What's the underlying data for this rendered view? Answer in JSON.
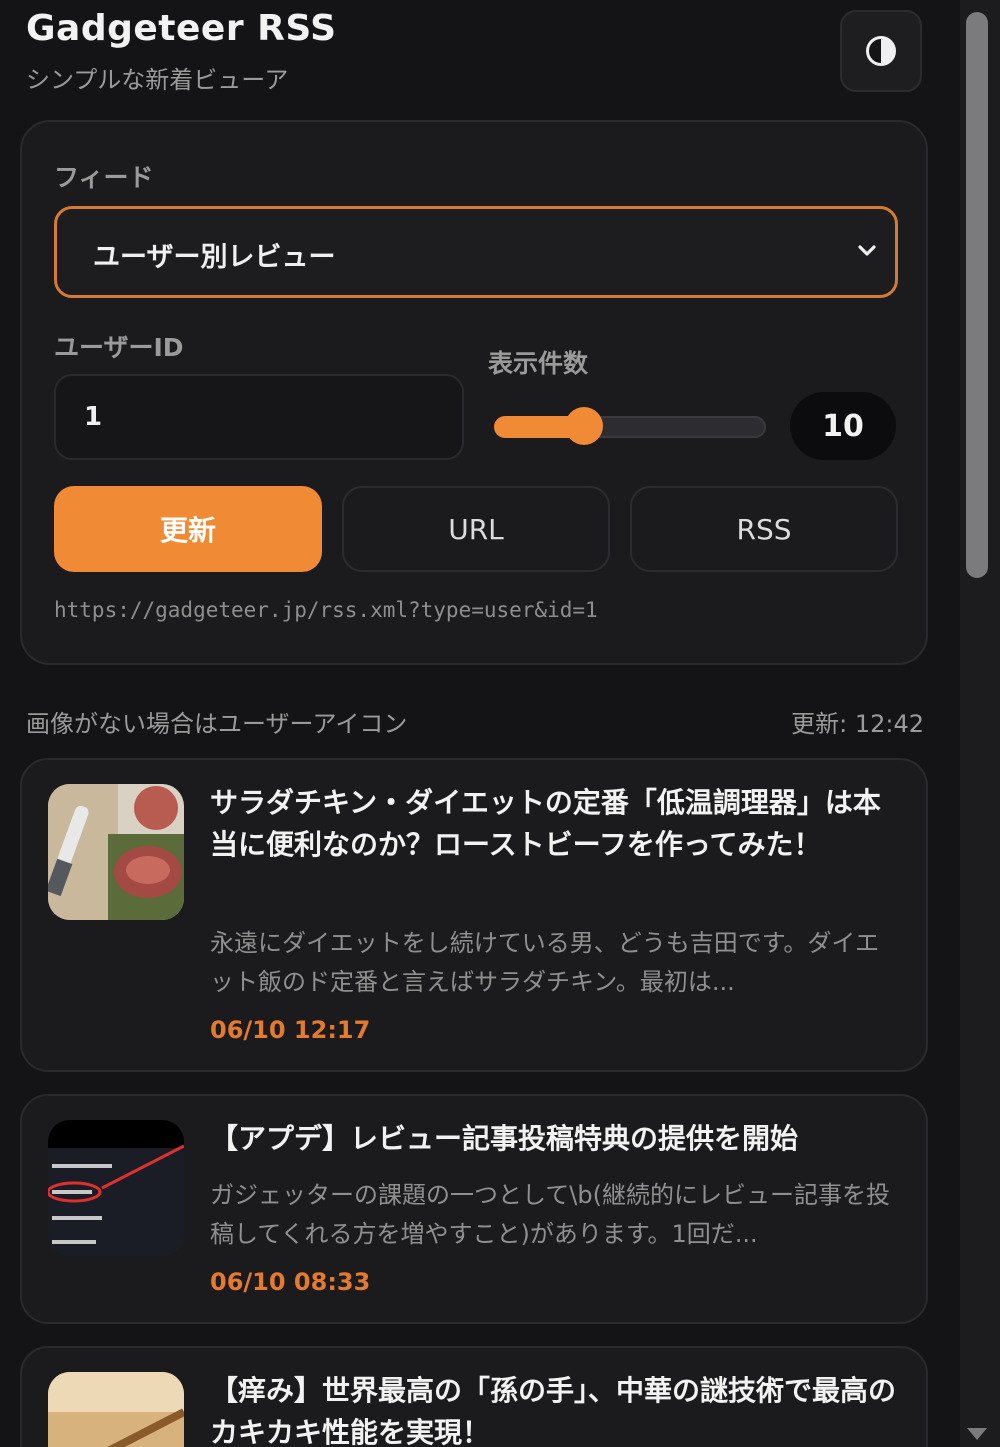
{
  "header": {
    "title": "Gadgeteer RSS",
    "subtitle": "シンプルな新着ビューア",
    "theme_icon": "contrast-icon"
  },
  "controls": {
    "feed_label": "フィード",
    "feed_selected": "ユーザー別レビュー",
    "userid_label": "ユーザーID",
    "userid_value": "1",
    "count_label": "表示件数",
    "count_value": "10",
    "slider_fraction": 0.33,
    "refresh_label": "更新",
    "url_label": "URL",
    "rss_label": "RSS",
    "feed_url": "https://gadgeteer.jp/rss.xml?type=user&id=1"
  },
  "status": {
    "note": "画像がない場合はユーザーアイコン",
    "updated": "更新: 12:42"
  },
  "articles": [
    {
      "title": "サラダチキン・ダイエットの定番「低温調理器」は本当に便利なのか？ローストビーフを作ってみた！",
      "excerpt": "永遠にダイエットをし続けている男、どうも吉田です。ダイエット飯のド定番と言えばサラダチキン。最初は...",
      "date": "06/10 12:17"
    },
    {
      "title": "【アプデ】レビュー記事投稿特典の提供を開始",
      "excerpt": "ガジェッターの課題の一つとして\\b(継続的にレビュー記事を投稿してくれる方を増やすこと)があります。1回だ...",
      "date": "06/10 08:33"
    },
    {
      "title": "【痒み】世界最高の「孫の手」、中華の謎技術で最高のカキカキ性能を実現！",
      "excerpt": "",
      "date": ""
    }
  ],
  "colors": {
    "accent": "#f08a34",
    "background": "#141416",
    "card": "#1b1b1e"
  }
}
